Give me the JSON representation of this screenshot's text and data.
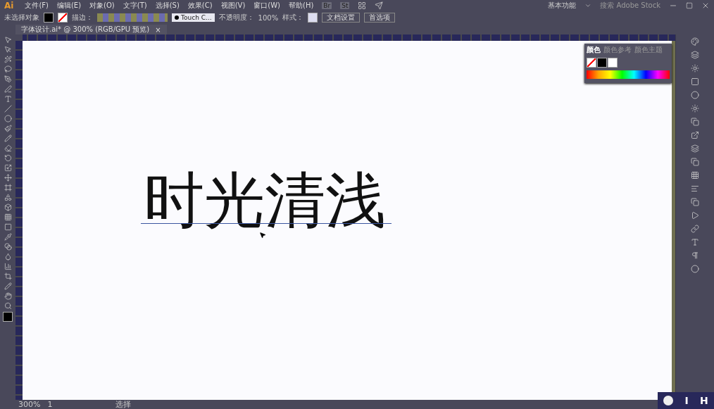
{
  "app": {
    "logo": "Ai"
  },
  "menu": [
    "文件(F)",
    "编辑(E)",
    "对象(O)",
    "文字(T)",
    "选择(S)",
    "效果(C)",
    "视图(V)",
    "窗口(W)",
    "帮助(H)"
  ],
  "app_buttons": [
    "Br",
    "St"
  ],
  "workspace": {
    "label": "基本功能",
    "search_placeholder": "搜索 Adobe Stock"
  },
  "control_bar": {
    "selection": "未选择对象",
    "stroke_label": "描边：",
    "brush": "Touch C...",
    "opacity_label": "不透明度：",
    "opacity": "100%",
    "style_label": "样式：",
    "buttons": [
      "文档设置",
      "首选项"
    ]
  },
  "document_tab": {
    "title": "字体设计.ai* @ 300% (RGB/GPU 预览)",
    "close": "×"
  },
  "canvas": {
    "text": "时光清浅"
  },
  "color_panel": {
    "tabs": [
      {
        "label": "颜色",
        "selected": true
      },
      {
        "label": "颜色参考",
        "selected": false
      },
      {
        "label": "颜色主题",
        "selected": false
      }
    ]
  },
  "status_bar": {
    "zoom": "300%",
    "artboard": "1",
    "tool": "选择"
  },
  "key_overlay": {
    "keys": [
      "I",
      "H"
    ]
  }
}
